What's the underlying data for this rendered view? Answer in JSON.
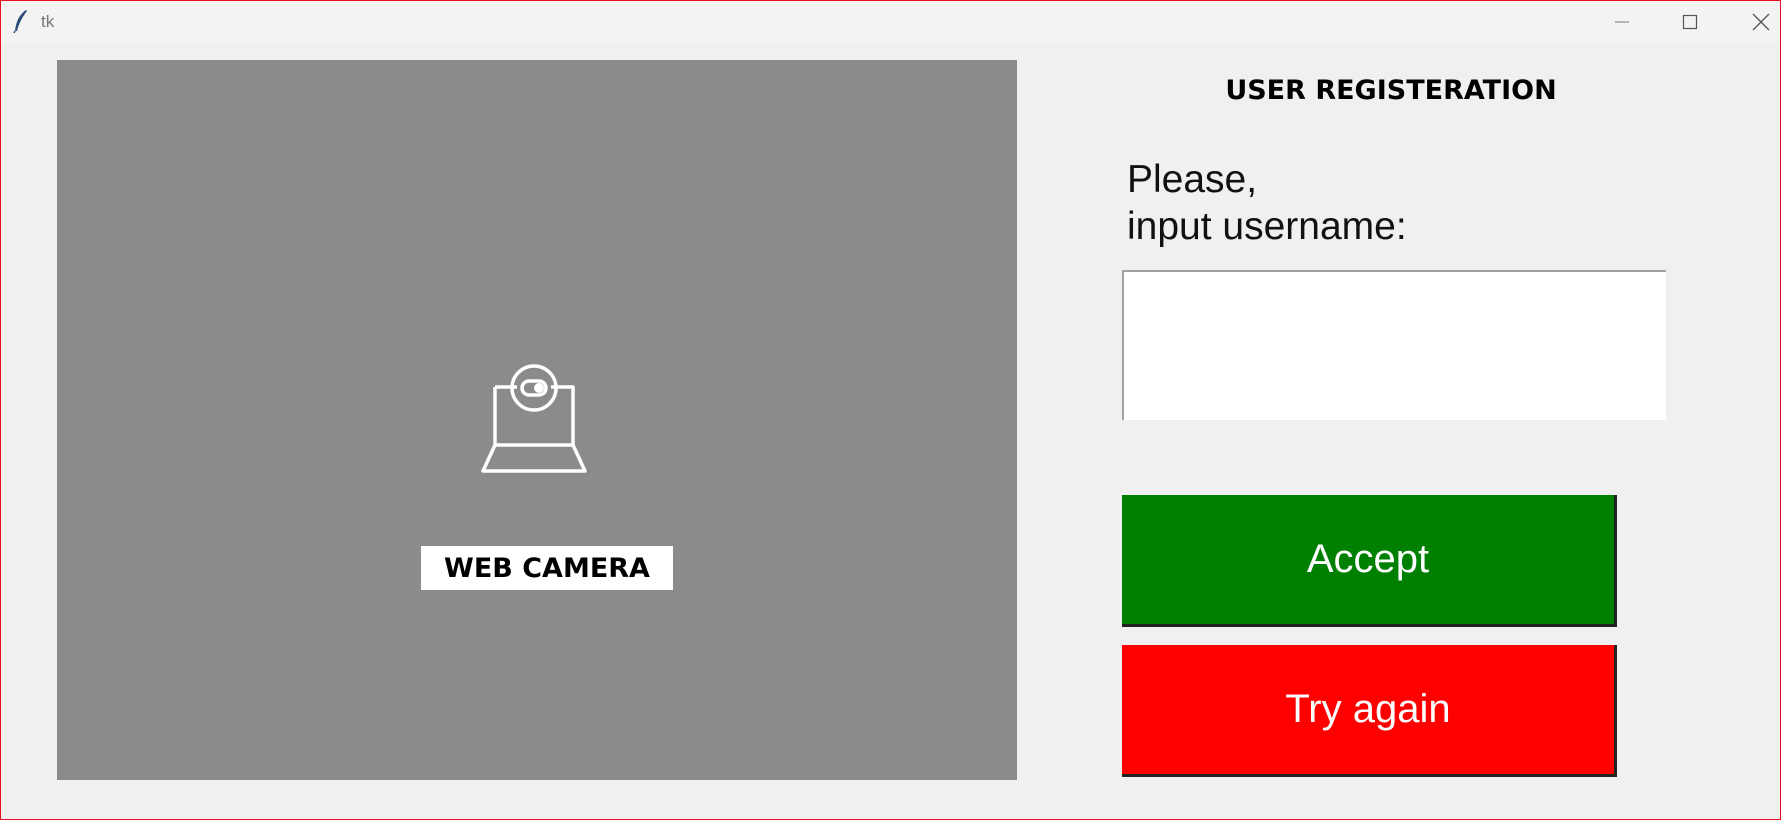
{
  "window": {
    "title": "tk",
    "icons": {
      "app": "feather-icon",
      "minimize": "minimize-icon",
      "maximize": "maximize-icon",
      "close": "close-icon"
    },
    "border_color": "#e81123"
  },
  "camera": {
    "label": "WEB CAMERA",
    "icon": "webcam-icon",
    "background_color": "#8b8b8d"
  },
  "registration": {
    "title": "USER REGISTERATION",
    "prompt_line1": "Please,",
    "prompt_line2": "input username:",
    "username_value": ""
  },
  "buttons": {
    "accept_label": "Accept",
    "accept_color": "#008000",
    "retry_label": "Try again",
    "retry_color": "#ff0000"
  }
}
